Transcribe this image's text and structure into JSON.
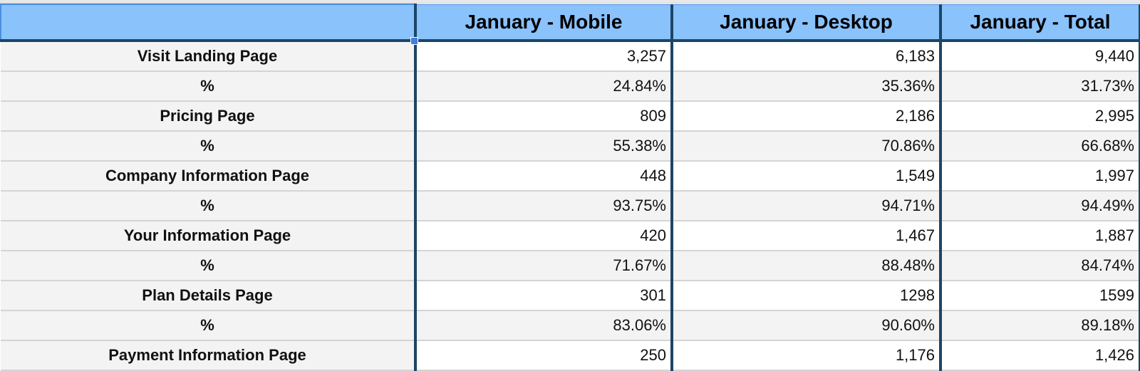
{
  "header": {
    "corner": "",
    "columns": [
      "January - Mobile",
      "January - Desktop",
      "January - Total"
    ]
  },
  "rows": [
    {
      "label": "Visit Landing Page",
      "values": [
        "3,257",
        "6,183",
        "9,440"
      ]
    },
    {
      "label": "%",
      "values": [
        "24.84%",
        "35.36%",
        "31.73%"
      ]
    },
    {
      "label": "Pricing Page",
      "values": [
        "809",
        "2,186",
        "2,995"
      ]
    },
    {
      "label": "%",
      "values": [
        "55.38%",
        "70.86%",
        "66.68%"
      ]
    },
    {
      "label": "Company Information Page",
      "values": [
        "448",
        "1,549",
        "1,997"
      ]
    },
    {
      "label": "%",
      "values": [
        "93.75%",
        "94.71%",
        "94.49%"
      ]
    },
    {
      "label": "Your Information Page",
      "values": [
        "420",
        "1,467",
        "1,887"
      ]
    },
    {
      "label": "%",
      "values": [
        "71.67%",
        "88.48%",
        "84.74%"
      ]
    },
    {
      "label": "Plan Details Page",
      "values": [
        "301",
        "1298",
        "1599"
      ]
    },
    {
      "label": "%",
      "values": [
        "83.06%",
        "90.60%",
        "89.18%"
      ]
    },
    {
      "label": "Payment Information Page",
      "values": [
        "250",
        "1,176",
        "1,426"
      ]
    }
  ],
  "colors": {
    "header_bg": "#8ac2fc",
    "border": "#1d4566",
    "selection": "#3f7fe0",
    "alt_row": "#f3f3f3"
  }
}
